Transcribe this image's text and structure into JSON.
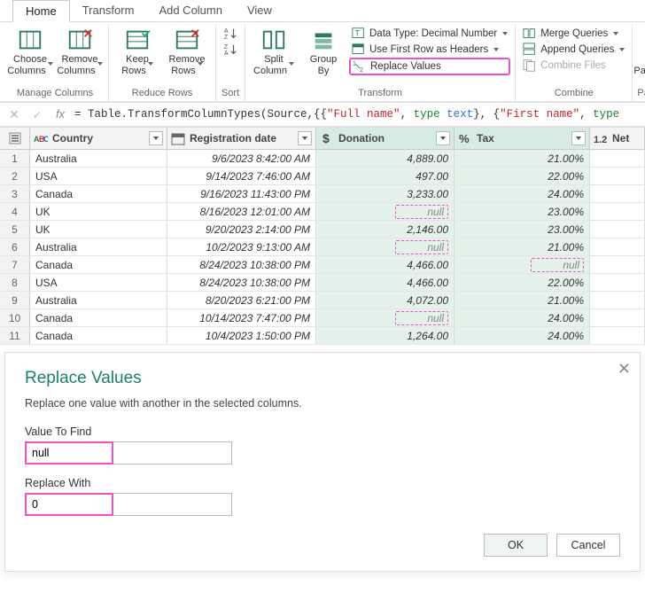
{
  "tabs": [
    "Home",
    "Transform",
    "Add Column",
    "View"
  ],
  "active_tab": 0,
  "ribbon": {
    "groups": [
      {
        "label": "Manage Columns",
        "big": [
          {
            "label": "Choose\nColumns",
            "name": "choose-columns-button",
            "dd": true
          },
          {
            "label": "Remove\nColumns",
            "name": "remove-columns-button",
            "dd": true
          }
        ]
      },
      {
        "label": "Reduce Rows",
        "big": [
          {
            "label": "Keep\nRows",
            "name": "keep-rows-button",
            "dd": true
          },
          {
            "label": "Remove\nRows",
            "name": "remove-rows-button",
            "dd": true
          }
        ]
      },
      {
        "label": "Sort",
        "small": [
          {
            "name": "sort-asc-button"
          },
          {
            "name": "sort-desc-button"
          }
        ]
      },
      {
        "label": "Transform",
        "big": [
          {
            "label": "Split\nColumn",
            "name": "split-column-button",
            "dd": true
          },
          {
            "label": "Group\nBy",
            "name": "group-by-button",
            "dd": false
          }
        ],
        "stack": [
          {
            "label": "Data Type: Decimal Number",
            "name": "data-type-button",
            "dd": true
          },
          {
            "label": "Use First Row as Headers",
            "name": "first-row-headers-button",
            "dd": true
          },
          {
            "label": "Replace Values",
            "name": "replace-values-button",
            "dd": false,
            "hl": true
          }
        ]
      },
      {
        "label": "Combine",
        "stack": [
          {
            "label": "Merge Queries",
            "name": "merge-queries-button",
            "dd": true
          },
          {
            "label": "Append Queries",
            "name": "append-queries-button",
            "dd": true
          },
          {
            "label": "Combine Files",
            "name": "combine-files-button",
            "disabled": true
          }
        ]
      },
      {
        "label": "Parameters",
        "big": [
          {
            "label": "Manage\nParameters",
            "name": "manage-parameters-button",
            "dd": true
          }
        ]
      }
    ]
  },
  "formula": {
    "prefix": "= Table.TransformColumnTypes(Source,{{",
    "s1": "\"Full name\"",
    "t1": "type text",
    "sep": "}, {",
    "s2": "\"First name\"",
    "t2": "type",
    "suffix": ""
  },
  "columns": [
    {
      "name": "Country",
      "type_icon": "abc",
      "width_cls": "c-country"
    },
    {
      "name": "Registration date",
      "type_icon": "cal",
      "width_cls": "c-reg"
    },
    {
      "name": "Donation",
      "type_icon": "dollar",
      "width_cls": "c-don",
      "selected": true
    },
    {
      "name": "Tax",
      "type_icon": "pct",
      "width_cls": "c-tax",
      "selected": true
    },
    {
      "name": "Net",
      "type_icon": "12",
      "width_cls": "c-net",
      "last": true
    }
  ],
  "rows": [
    {
      "n": 1,
      "country": "Australia",
      "reg": "9/6/2023 8:42:00 AM",
      "don": "4,889.00",
      "tax": "21.00%"
    },
    {
      "n": 2,
      "country": "USA",
      "reg": "9/14/2023 7:46:00 AM",
      "don": "497.00",
      "tax": "22.00%"
    },
    {
      "n": 3,
      "country": "Canada",
      "reg": "9/16/2023 11:43:00 PM",
      "don": "3,233.00",
      "tax": "24.00%"
    },
    {
      "n": 4,
      "country": "UK",
      "reg": "8/16/2023 12:01:00 AM",
      "don": null,
      "tax": "23.00%",
      "don_null": true
    },
    {
      "n": 5,
      "country": "UK",
      "reg": "9/20/2023 2:14:00 PM",
      "don": "2,146.00",
      "tax": "23.00%"
    },
    {
      "n": 6,
      "country": "Australia",
      "reg": "10/2/2023 9:13:00 AM",
      "don": null,
      "tax": "21.00%",
      "don_null": true
    },
    {
      "n": 7,
      "country": "Canada",
      "reg": "8/24/2023 10:38:00 PM",
      "don": "4,466.00",
      "tax": null,
      "tax_null": true
    },
    {
      "n": 8,
      "country": "USA",
      "reg": "8/24/2023 10:38:00 PM",
      "don": "4,466.00",
      "tax": "22.00%"
    },
    {
      "n": 9,
      "country": "Australia",
      "reg": "8/20/2023 6:21:00 PM",
      "don": "4,072.00",
      "tax": "21.00%"
    },
    {
      "n": 10,
      "country": "Canada",
      "reg": "10/14/2023 7:47:00 PM",
      "don": null,
      "tax": "24.00%",
      "don_null": true
    },
    {
      "n": 11,
      "country": "Canada",
      "reg": "10/4/2023 1:50:00 PM",
      "don": "1,264.00",
      "tax": "24.00%"
    }
  ],
  "dialog": {
    "title": "Replace Values",
    "desc": "Replace one value with another in the selected columns.",
    "find_label": "Value To Find",
    "find_value": "null",
    "replace_label": "Replace With",
    "replace_value": "0",
    "ok": "OK",
    "cancel": "Cancel"
  }
}
